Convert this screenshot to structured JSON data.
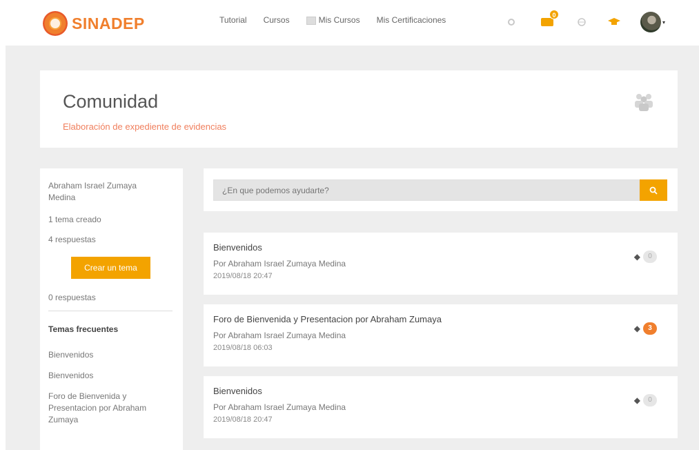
{
  "brand": {
    "logo_text": "SINADEP"
  },
  "nav": {
    "links": [
      "Tutorial",
      "Cursos",
      "Mis Cursos",
      "Mis Certificaciones"
    ],
    "cert_badge": "0",
    "icons": [
      "gear-icon",
      "certificate-icon",
      "globe-icon",
      "graduation-cap-icon"
    ]
  },
  "header": {
    "title": "Comunidad",
    "subtitle": "Elaboración de expediente de evidencias"
  },
  "sidebar": {
    "user_name": "Abraham Israel Zumaya Medina",
    "topics_created": "1 tema creado",
    "replies": "4 respuestas",
    "create_button": "Crear un tema",
    "published": "0 respuestas",
    "frequent_heading": "Temas frecuentes",
    "frequent": [
      "Bienvenidos",
      "Bienvenidos",
      "Foro de Bienvenida y Presentacion por Abraham Zumaya"
    ]
  },
  "search": {
    "placeholder": "¿En que podemos ayudarte?"
  },
  "topics": [
    {
      "title": "Bienvenidos",
      "author": "Por Abraham Israel Zumaya Medina",
      "date": "2019/08/18 20:47",
      "replies": "0"
    },
    {
      "title": "Foro de Bienvenida y Presentacion por Abraham Zumaya",
      "author": "Por Abraham Israel Zumaya Medina",
      "date": "2019/08/18 06:03",
      "replies": "3"
    },
    {
      "title": "Bienvenidos",
      "author": "Por Abraham Israel Zumaya Medina",
      "date": "2019/08/18 20:47",
      "replies": "0"
    }
  ],
  "colors": {
    "accent": "#f3a300",
    "brand": "#f07f2d",
    "subtitle": "#f07f5d",
    "background": "#eeeeee"
  }
}
